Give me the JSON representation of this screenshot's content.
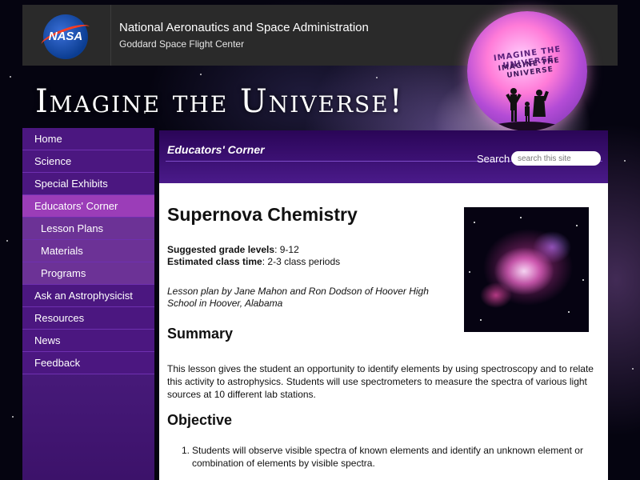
{
  "header": {
    "agency_logo_text": "NASA",
    "agency_title": "National Aeronautics and Space Administration",
    "center_name": "Goddard Space Flight Center",
    "badge_line1": "IMAGINE THE UNIVERSE",
    "badge_line2": "IMAGINE THE UNIVERSE",
    "site_title": "Imagine the Universe!"
  },
  "sidebar": {
    "items": [
      {
        "label": "Home"
      },
      {
        "label": "Science"
      },
      {
        "label": "Special Exhibits"
      },
      {
        "label": "Educators' Corner"
      },
      {
        "label": "Lesson Plans"
      },
      {
        "label": "Materials"
      },
      {
        "label": "Programs"
      },
      {
        "label": "Ask an Astrophysicist"
      },
      {
        "label": "Resources"
      },
      {
        "label": "News"
      },
      {
        "label": "Feedback"
      }
    ]
  },
  "content": {
    "section_title": "Educators' Corner",
    "search_label": "Search",
    "search_placeholder": "search this site",
    "page_title": "Supernova Chemistry",
    "grade_label": "Suggested grade levels",
    "grade_value": ": 9-12",
    "time_label": "Estimated class time",
    "time_value": ": 2-3 class periods",
    "credit": "Lesson plan by Jane Mahon and Ron Dodson of Hoover High School in Hoover, Alabama",
    "summary_heading": "Summary",
    "summary_text": "This lesson gives the student an opportunity to identify elements by using spectroscopy and to relate this activity to astrophysics. Students will use spectrometers to measure the spectra of various light sources at 10 different lab stations.",
    "objective_heading": "Objective",
    "objectives": [
      {
        "num": "1.",
        "text": "Students will observe visible spectra of known elements and identify an unknown element or combination of elements by visible spectra."
      }
    ]
  },
  "colors": {
    "nav_bg": "#4b1780",
    "nav_active": "#9b3db8",
    "nav_sub": "#6c3296",
    "header_bar": "#2a2a2a"
  }
}
